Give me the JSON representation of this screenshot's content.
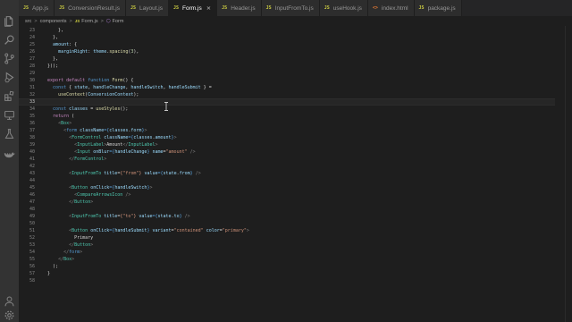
{
  "tabs": [
    {
      "icon": "JS",
      "label": "App.js",
      "active": false
    },
    {
      "icon": "JS",
      "label": "ConversionResult.js",
      "active": false
    },
    {
      "icon": "JS",
      "label": "Layout.js",
      "active": false
    },
    {
      "icon": "JS",
      "label": "Form.js",
      "active": true
    },
    {
      "icon": "JS",
      "label": "Header.js",
      "active": false
    },
    {
      "icon": "JS",
      "label": "InputFromTo.js",
      "active": false
    },
    {
      "icon": "JS",
      "label": "useHook.js",
      "active": false
    },
    {
      "icon": "<>",
      "label": "index.html",
      "active": false
    },
    {
      "icon": "JS",
      "label": "package.js",
      "active": false
    }
  ],
  "tab_close": "×",
  "breadcrumb": {
    "parts": [
      "src",
      "components"
    ],
    "separator": ">",
    "file_icon": "JS",
    "file": "Form.js",
    "symbol": "Form"
  },
  "colors": {
    "keyword": "#c586c0",
    "storage": "#569cd6",
    "function": "#dcdcaa",
    "variable": "#9cdcfe",
    "component": "#4ec9b0",
    "string": "#ce9178",
    "number": "#b5cea8",
    "tag_bracket": "#808080",
    "text": "#d4d4d4"
  },
  "current_line": 33,
  "code_lines": [
    {
      "n": "23",
      "t": [
        [
          "      },",
          "text"
        ]
      ]
    },
    {
      "n": "24",
      "t": [
        [
          "    },",
          "text"
        ]
      ]
    },
    {
      "n": "25",
      "t": [
        [
          "    ",
          "text"
        ],
        [
          "amount",
          "variable"
        ],
        [
          ": {",
          "text"
        ]
      ]
    },
    {
      "n": "26",
      "t": [
        [
          "      ",
          "text"
        ],
        [
          "marginRight",
          "variable"
        ],
        [
          ": ",
          "text"
        ],
        [
          "theme",
          "variable"
        ],
        [
          ".",
          "text"
        ],
        [
          "spacing",
          "function"
        ],
        [
          "(",
          "text"
        ],
        [
          "3",
          "number"
        ],
        [
          "),",
          "text"
        ]
      ]
    },
    {
      "n": "27",
      "t": [
        [
          "    },",
          "text"
        ]
      ]
    },
    {
      "n": "28",
      "t": [
        [
          "  }));",
          "text"
        ]
      ]
    },
    {
      "n": "29",
      "t": []
    },
    {
      "n": "30",
      "t": [
        [
          "  ",
          "text"
        ],
        [
          "export default",
          "keyword"
        ],
        [
          " ",
          "text"
        ],
        [
          "function",
          "storage"
        ],
        [
          " ",
          "text"
        ],
        [
          "Form",
          "function"
        ],
        [
          "() {",
          "text"
        ]
      ]
    },
    {
      "n": "31",
      "t": [
        [
          "    ",
          "text"
        ],
        [
          "const",
          "storage"
        ],
        [
          " { ",
          "text"
        ],
        [
          "state",
          "variable"
        ],
        [
          ", ",
          "text"
        ],
        [
          "handleChange",
          "variable"
        ],
        [
          ", ",
          "text"
        ],
        [
          "handleSwitch",
          "variable"
        ],
        [
          ", ",
          "text"
        ],
        [
          "handleSubmit",
          "variable"
        ],
        [
          " } =",
          "text"
        ]
      ]
    },
    {
      "n": "32",
      "t": [
        [
          "      ",
          "text"
        ],
        [
          "useContext",
          "function"
        ],
        [
          "(",
          "text"
        ],
        [
          "ConversionContext",
          "variable"
        ],
        [
          ");",
          "text"
        ]
      ]
    },
    {
      "n": "33",
      "t": []
    },
    {
      "n": "34",
      "t": [
        [
          "    ",
          "text"
        ],
        [
          "const",
          "storage"
        ],
        [
          " ",
          "text"
        ],
        [
          "classes",
          "variable"
        ],
        [
          " = ",
          "text"
        ],
        [
          "useStyles",
          "function"
        ],
        [
          "();",
          "text"
        ]
      ]
    },
    {
      "n": "35",
      "t": [
        [
          "    ",
          "text"
        ],
        [
          "return",
          "keyword"
        ],
        [
          " (",
          "text"
        ]
      ]
    },
    {
      "n": "36",
      "t": [
        [
          "      ",
          "text"
        ],
        [
          "<",
          "tag_bracket"
        ],
        [
          "Box",
          "component"
        ],
        [
          ">",
          "tag_bracket"
        ]
      ]
    },
    {
      "n": "37",
      "t": [
        [
          "        ",
          "text"
        ],
        [
          "<",
          "tag_bracket"
        ],
        [
          "form",
          "storage"
        ],
        [
          " ",
          "text"
        ],
        [
          "className",
          "variable"
        ],
        [
          "={",
          "storage"
        ],
        [
          "classes",
          "variable"
        ],
        [
          ".",
          "text"
        ],
        [
          "form",
          "variable"
        ],
        [
          "}",
          "storage"
        ],
        [
          ">",
          "tag_bracket"
        ]
      ]
    },
    {
      "n": "38",
      "t": [
        [
          "          ",
          "text"
        ],
        [
          "<",
          "tag_bracket"
        ],
        [
          "FormControl",
          "component"
        ],
        [
          " ",
          "text"
        ],
        [
          "className",
          "variable"
        ],
        [
          "={",
          "storage"
        ],
        [
          "classes",
          "variable"
        ],
        [
          ".",
          "text"
        ],
        [
          "amount",
          "variable"
        ],
        [
          "}",
          "storage"
        ],
        [
          ">",
          "tag_bracket"
        ]
      ]
    },
    {
      "n": "39",
      "t": [
        [
          "            ",
          "text"
        ],
        [
          "<",
          "tag_bracket"
        ],
        [
          "InputLabel",
          "component"
        ],
        [
          ">",
          "tag_bracket"
        ],
        [
          "Amount",
          "text"
        ],
        [
          "</",
          "tag_bracket"
        ],
        [
          "InputLabel",
          "component"
        ],
        [
          ">",
          "tag_bracket"
        ]
      ]
    },
    {
      "n": "40",
      "t": [
        [
          "            ",
          "text"
        ],
        [
          "<",
          "tag_bracket"
        ],
        [
          "Input",
          "component"
        ],
        [
          " ",
          "text"
        ],
        [
          "onBlur",
          "variable"
        ],
        [
          "={",
          "storage"
        ],
        [
          "handleChange",
          "variable"
        ],
        [
          "}",
          "storage"
        ],
        [
          " ",
          "text"
        ],
        [
          "name",
          "variable"
        ],
        [
          "=",
          "text"
        ],
        [
          "\"amount\"",
          "string"
        ],
        [
          " />",
          "tag_bracket"
        ]
      ]
    },
    {
      "n": "41",
      "t": [
        [
          "          ",
          "text"
        ],
        [
          "</",
          "tag_bracket"
        ],
        [
          "FormControl",
          "component"
        ],
        [
          ">",
          "tag_bracket"
        ]
      ]
    },
    {
      "n": "42",
      "t": []
    },
    {
      "n": "43",
      "t": [
        [
          "          ",
          "text"
        ],
        [
          "<",
          "tag_bracket"
        ],
        [
          "InputFromTo",
          "component"
        ],
        [
          " ",
          "text"
        ],
        [
          "title",
          "variable"
        ],
        [
          "=",
          "text"
        ],
        [
          "{\"from\"}",
          "string"
        ],
        [
          " ",
          "text"
        ],
        [
          "value",
          "variable"
        ],
        [
          "={",
          "storage"
        ],
        [
          "state",
          "variable"
        ],
        [
          ".",
          "text"
        ],
        [
          "from",
          "variable"
        ],
        [
          "}",
          "storage"
        ],
        [
          " />",
          "tag_bracket"
        ]
      ]
    },
    {
      "n": "44",
      "t": []
    },
    {
      "n": "45",
      "t": [
        [
          "          ",
          "text"
        ],
        [
          "<",
          "tag_bracket"
        ],
        [
          "Button",
          "component"
        ],
        [
          " ",
          "text"
        ],
        [
          "onClick",
          "variable"
        ],
        [
          "={",
          "storage"
        ],
        [
          "handleSwitch",
          "variable"
        ],
        [
          "}",
          "storage"
        ],
        [
          ">",
          "tag_bracket"
        ]
      ]
    },
    {
      "n": "46",
      "t": [
        [
          "            ",
          "text"
        ],
        [
          "<",
          "tag_bracket"
        ],
        [
          "CompareArrowsIcon",
          "component"
        ],
        [
          " />",
          "tag_bracket"
        ]
      ]
    },
    {
      "n": "47",
      "t": [
        [
          "          ",
          "text"
        ],
        [
          "</",
          "tag_bracket"
        ],
        [
          "Button",
          "component"
        ],
        [
          ">",
          "tag_bracket"
        ]
      ]
    },
    {
      "n": "48",
      "t": []
    },
    {
      "n": "49",
      "t": [
        [
          "          ",
          "text"
        ],
        [
          "<",
          "tag_bracket"
        ],
        [
          "InputFromTo",
          "component"
        ],
        [
          " ",
          "text"
        ],
        [
          "title",
          "variable"
        ],
        [
          "=",
          "text"
        ],
        [
          "{\"to\"}",
          "string"
        ],
        [
          " ",
          "text"
        ],
        [
          "value",
          "variable"
        ],
        [
          "={",
          "storage"
        ],
        [
          "state",
          "variable"
        ],
        [
          ".",
          "text"
        ],
        [
          "to",
          "variable"
        ],
        [
          "}",
          "storage"
        ],
        [
          " />",
          "tag_bracket"
        ]
      ]
    },
    {
      "n": "50",
      "t": []
    },
    {
      "n": "51",
      "t": [
        [
          "          ",
          "text"
        ],
        [
          "<",
          "tag_bracket"
        ],
        [
          "Button",
          "component"
        ],
        [
          " ",
          "text"
        ],
        [
          "onClick",
          "variable"
        ],
        [
          "={",
          "storage"
        ],
        [
          "handleSubmit",
          "variable"
        ],
        [
          "}",
          "storage"
        ],
        [
          " ",
          "text"
        ],
        [
          "variant",
          "variable"
        ],
        [
          "=",
          "text"
        ],
        [
          "\"contained\"",
          "string"
        ],
        [
          " ",
          "text"
        ],
        [
          "color",
          "variable"
        ],
        [
          "=",
          "text"
        ],
        [
          "\"primary\"",
          "string"
        ],
        [
          ">",
          "tag_bracket"
        ]
      ]
    },
    {
      "n": "52",
      "t": [
        [
          "            Primary",
          "text"
        ]
      ]
    },
    {
      "n": "53",
      "t": [
        [
          "          ",
          "text"
        ],
        [
          "</",
          "tag_bracket"
        ],
        [
          "Button",
          "component"
        ],
        [
          ">",
          "tag_bracket"
        ]
      ]
    },
    {
      "n": "54",
      "t": [
        [
          "        ",
          "text"
        ],
        [
          "</",
          "tag_bracket"
        ],
        [
          "form",
          "storage"
        ],
        [
          ">",
          "tag_bracket"
        ]
      ]
    },
    {
      "n": "55",
      "t": [
        [
          "      ",
          "text"
        ],
        [
          "</",
          "tag_bracket"
        ],
        [
          "Box",
          "component"
        ],
        [
          ">",
          "tag_bracket"
        ]
      ]
    },
    {
      "n": "56",
      "t": [
        [
          "    );",
          "text"
        ]
      ]
    },
    {
      "n": "57",
      "t": [
        [
          "  }",
          "text"
        ]
      ]
    },
    {
      "n": "58",
      "t": []
    }
  ]
}
